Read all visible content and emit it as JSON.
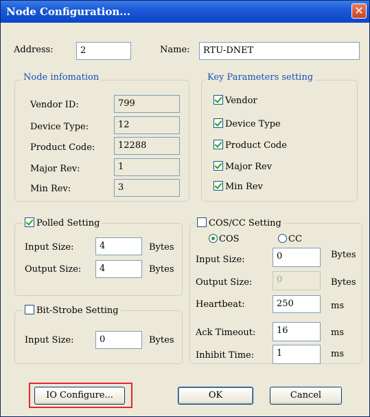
{
  "window": {
    "title": "Node Configuration...",
    "close_glyph": "✕"
  },
  "top": {
    "address_label": "Address:",
    "address_value": "2",
    "name_label": "Name:",
    "name_value": "RTU-DNET"
  },
  "node_info": {
    "legend": "Node infomation",
    "rows": [
      {
        "label": "Vendor ID:",
        "value": "799"
      },
      {
        "label": "Device Type:",
        "value": "12"
      },
      {
        "label": "Product Code:",
        "value": "12288"
      },
      {
        "label": "Major Rev:",
        "value": "1"
      },
      {
        "label": "Min Rev:",
        "value": "3"
      }
    ]
  },
  "key_params": {
    "legend": "Key Parameters setting",
    "items": [
      {
        "label": "Vendor",
        "checked": true
      },
      {
        "label": "Device Type",
        "checked": true
      },
      {
        "label": "Product Code",
        "checked": true
      },
      {
        "label": "Major Rev",
        "checked": true
      },
      {
        "label": "Min Rev",
        "checked": true
      }
    ]
  },
  "polled": {
    "legend": "Polled Setting",
    "checked": true,
    "input_label": "Input Size:",
    "input_value": "4",
    "input_unit": "Bytes",
    "output_label": "Output Size:",
    "output_value": "4",
    "output_unit": "Bytes"
  },
  "bitstrobe": {
    "legend": "Bit-Strobe Setting",
    "checked": false,
    "input_label": "Input Size:",
    "input_value": "0",
    "input_unit": "Bytes"
  },
  "coscc": {
    "legend": "COS/CC Setting",
    "checked": false,
    "radio_cos": "COS",
    "radio_cc": "CC",
    "selected": "COS",
    "input_label": "Input Size:",
    "input_value": "0",
    "input_unit": "Bytes",
    "output_label": "Output Size:",
    "output_value": "0",
    "output_unit": "Bytes",
    "heartbeat_label": "Heartbeat:",
    "heartbeat_value": "250",
    "heartbeat_unit": "ms",
    "ack_label": "Ack Timeout:",
    "ack_value": "16",
    "ack_unit": "ms",
    "inhibit_label": "Inhibit Time:",
    "inhibit_value": "1",
    "inhibit_unit": "ms"
  },
  "buttons": {
    "io_configure": "IO Configure...",
    "ok": "OK",
    "cancel": "Cancel"
  },
  "colors": {
    "highlight": "#e8262a",
    "legend_blue": "#1a4fba",
    "check_green": "#21a121"
  }
}
